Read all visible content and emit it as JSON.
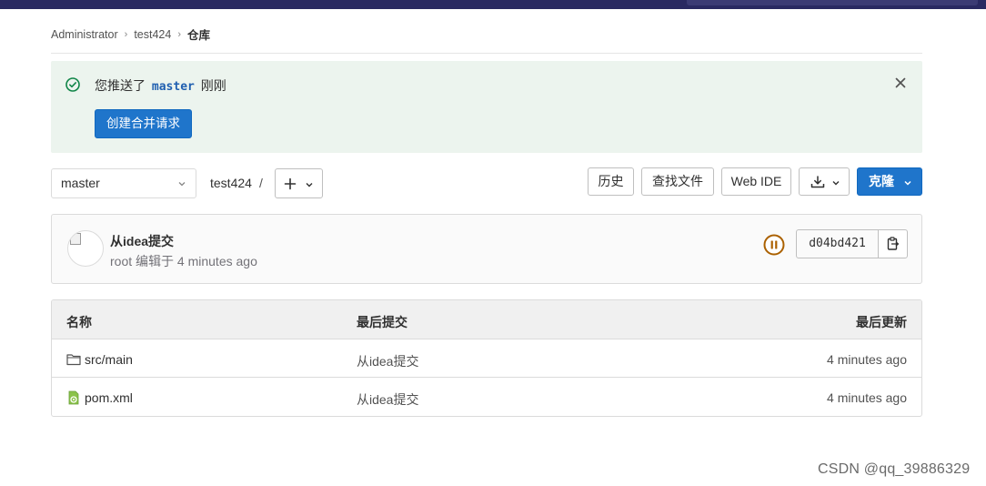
{
  "breadcrumb": {
    "items": [
      "Administrator",
      "test424",
      "仓库"
    ]
  },
  "alert": {
    "prefix": "您推送了",
    "branch": "master",
    "suffix": "刚刚",
    "button_label": "创建合并请求",
    "success_color": "#108548"
  },
  "repo_nav": {
    "branch_selected": "master",
    "path_root": "test424",
    "path_sep": "/"
  },
  "toolbar": {
    "history_label": "历史",
    "find_file_label": "查找文件",
    "web_ide_label": "Web IDE",
    "clone_label": "克隆"
  },
  "commit": {
    "title": "从idea提交",
    "author": "root",
    "action": "编辑于",
    "time": "4 minutes ago",
    "sha": "d04bd421",
    "pipeline_status": "paused",
    "pipeline_color": "#ab6100"
  },
  "file_table": {
    "headers": {
      "name": "名称",
      "last_commit": "最后提交",
      "last_update": "最后更新"
    },
    "rows": [
      {
        "name": "src/main",
        "icon": "folder-icon",
        "last_commit": "从idea提交",
        "last_update": "4 minutes ago"
      },
      {
        "name": "pom.xml",
        "icon": "maven-file-icon",
        "last_commit": "从idea提交",
        "last_update": "4 minutes ago"
      }
    ]
  },
  "watermark": "CSDN @qq_39886329",
  "colors": {
    "primary": "#1f75cb",
    "topbar": "#292961"
  }
}
